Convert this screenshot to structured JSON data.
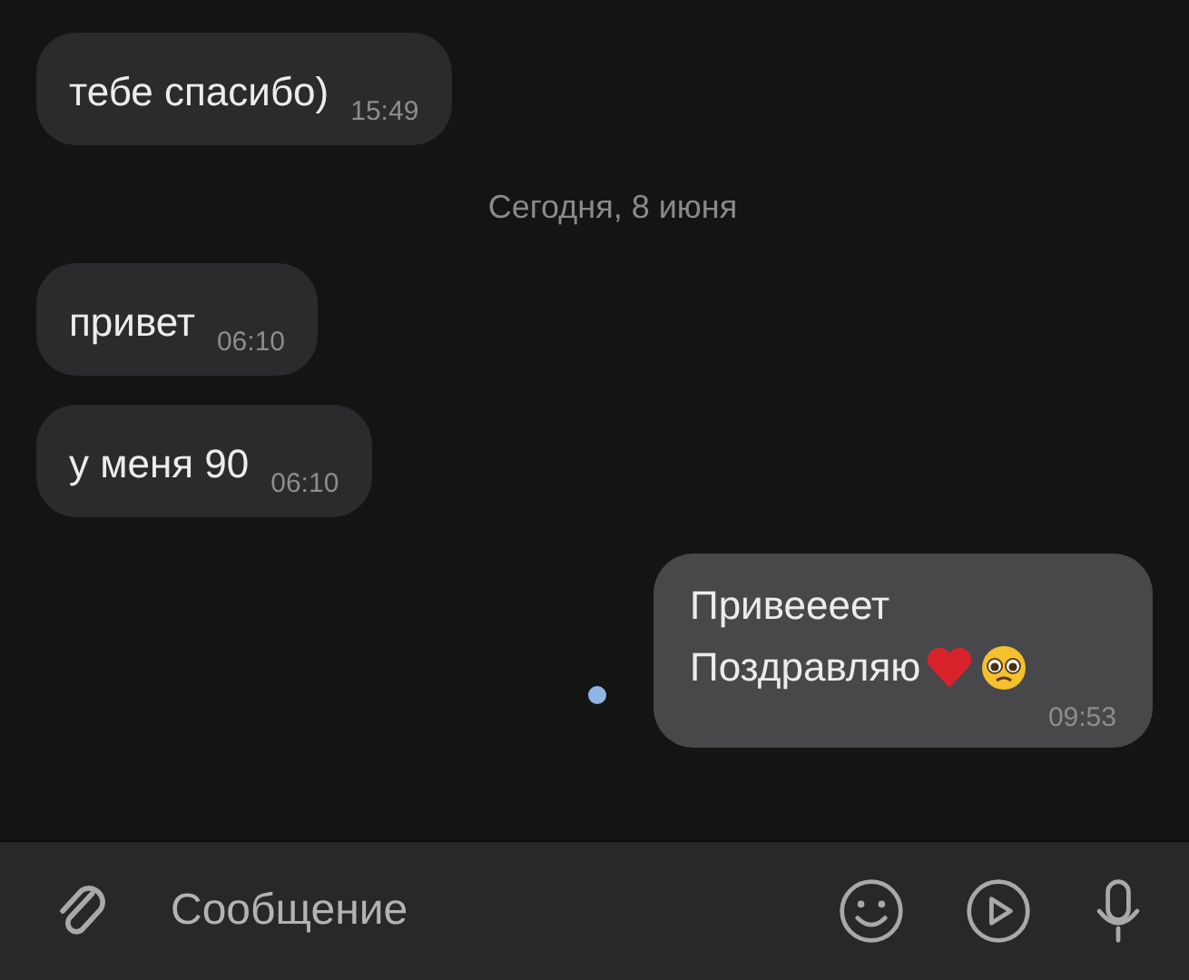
{
  "messages": [
    {
      "kind": "incoming",
      "lines": [
        "тебе спасибо)"
      ],
      "time": "15:49"
    },
    {
      "kind": "date",
      "text": "Сегодня, 8 июня"
    },
    {
      "kind": "incoming",
      "lines": [
        "привет"
      ],
      "time": "06:10"
    },
    {
      "kind": "incoming",
      "lines": [
        "у меня 90"
      ],
      "time": "06:10"
    },
    {
      "kind": "outgoing",
      "lines": [
        "Привеееет",
        "Поздравляю"
      ],
      "emoji": [
        {
          "kind": "heart"
        },
        {
          "kind": "pleading-face"
        }
      ],
      "time": "09:53",
      "unread": true
    }
  ],
  "composer": {
    "placeholder": "Сообщение"
  }
}
